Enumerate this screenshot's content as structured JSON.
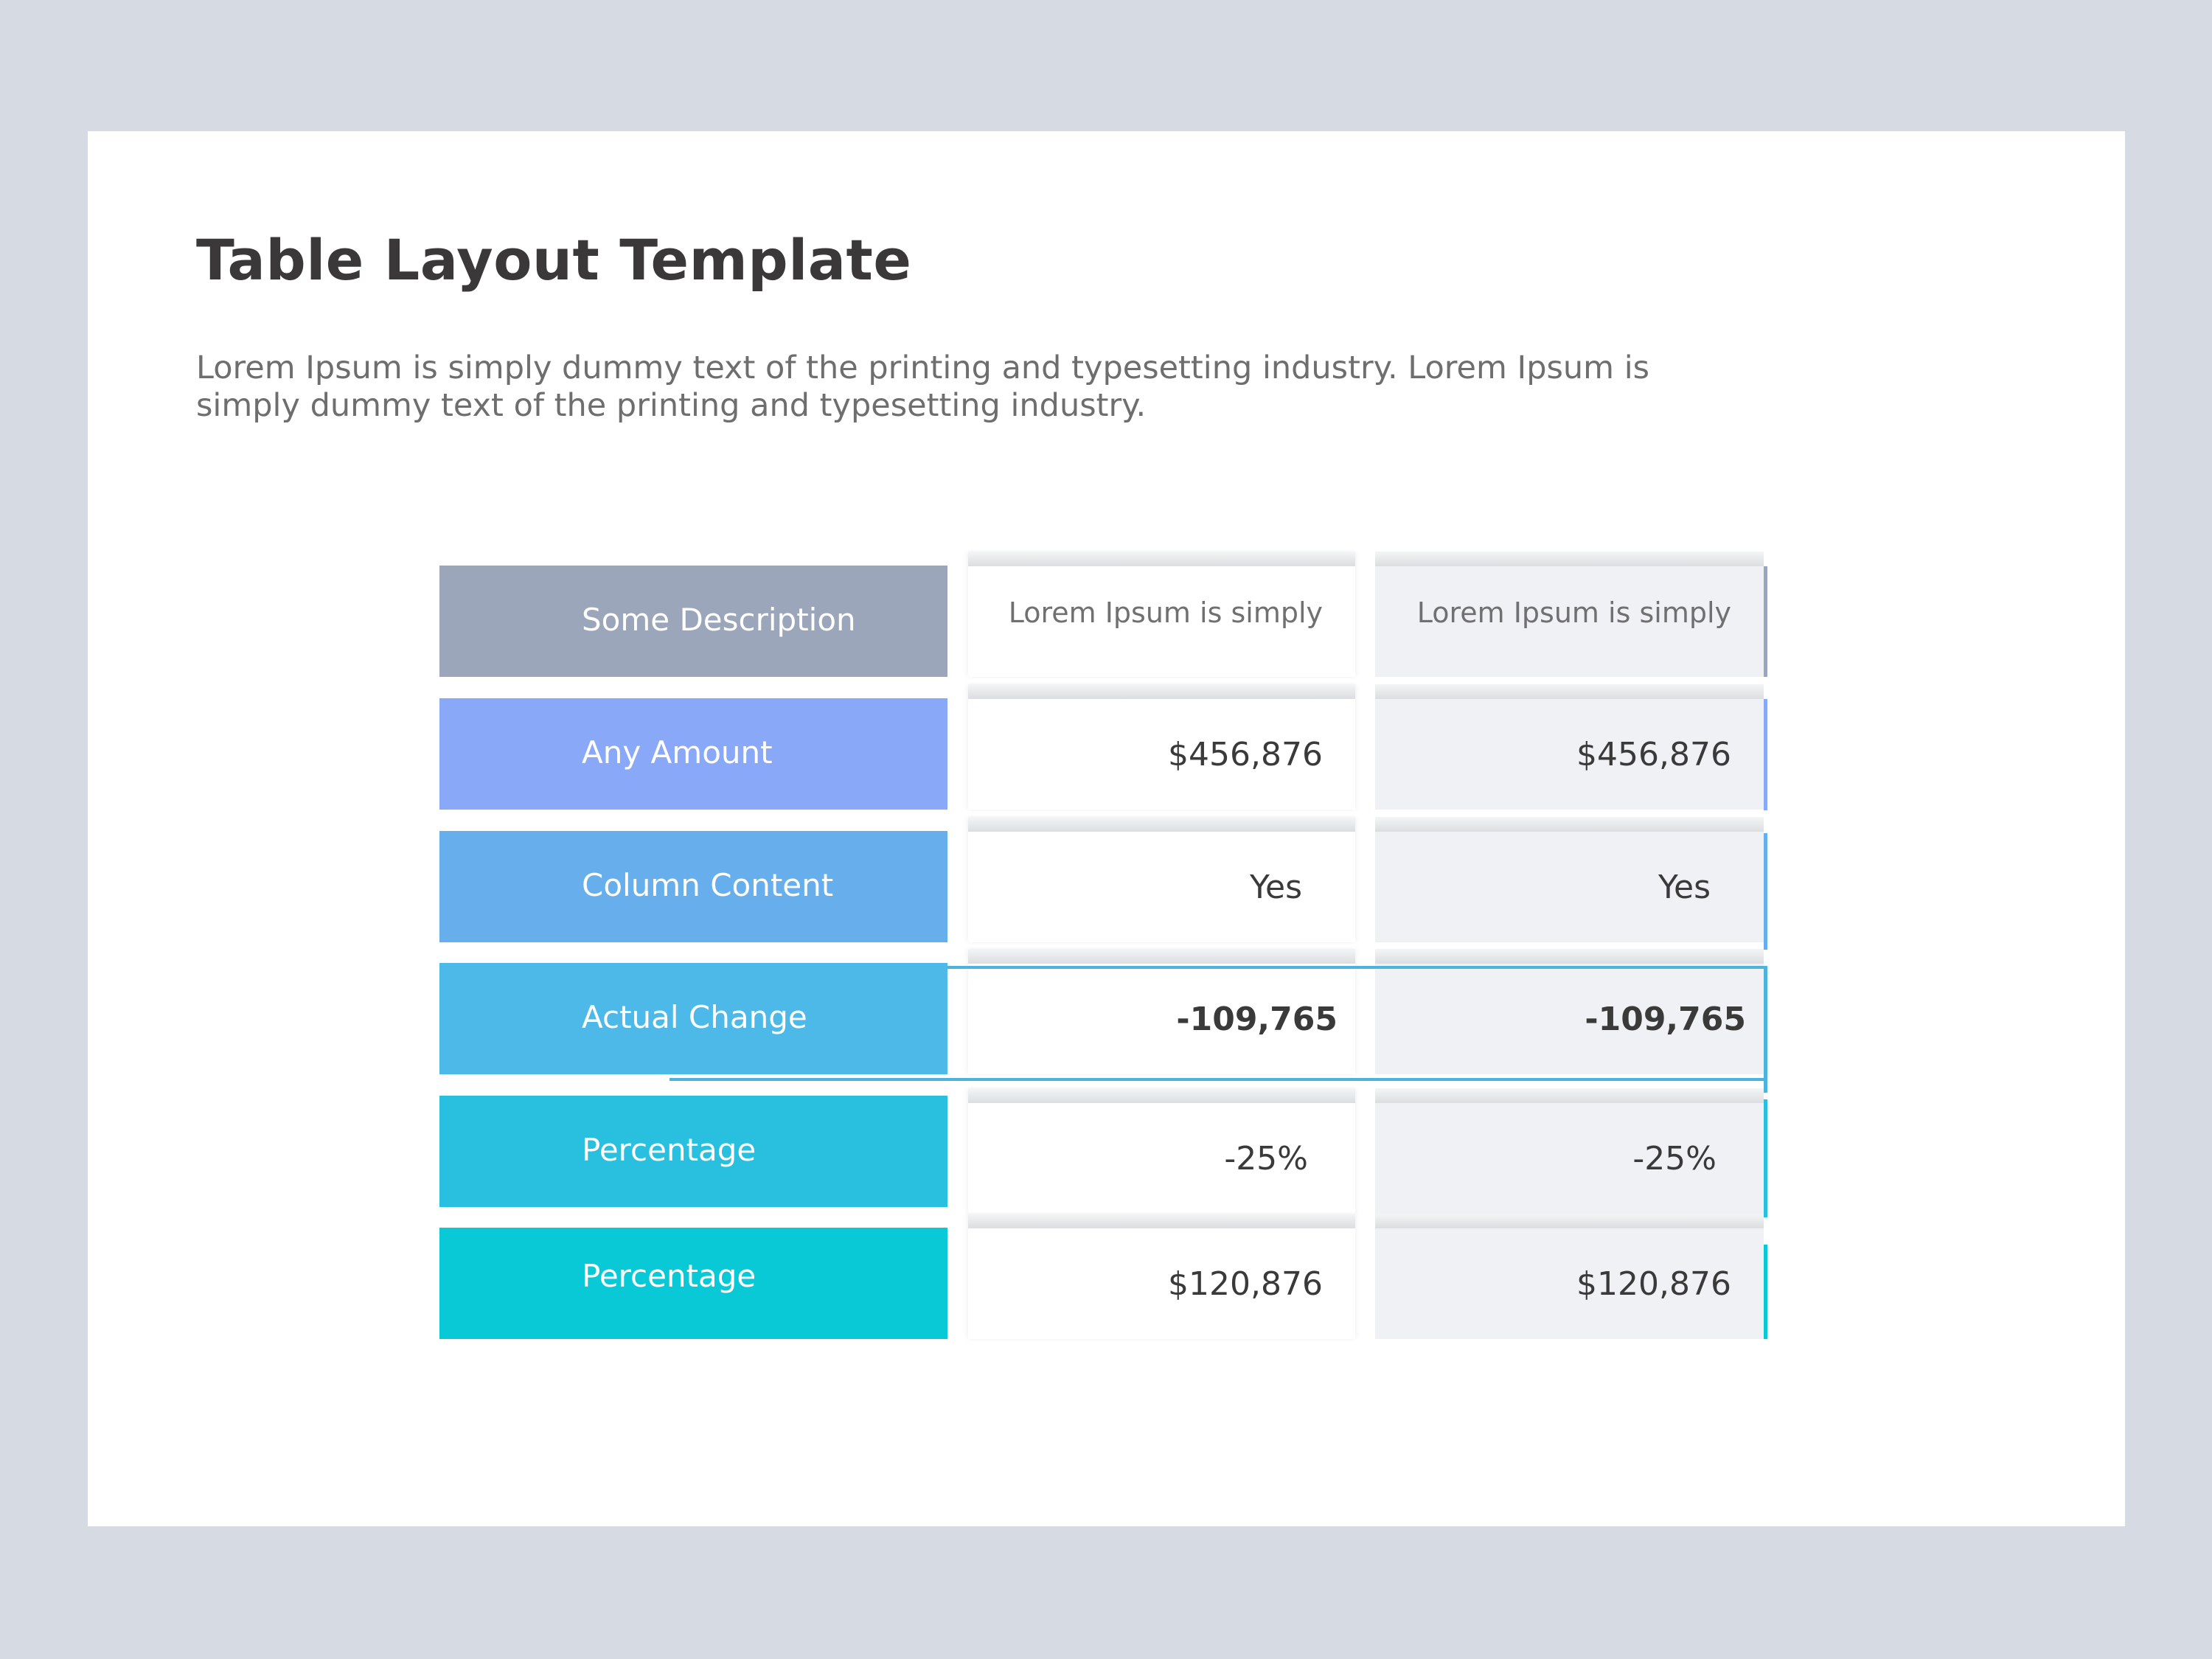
{
  "slide": {
    "title": "Table Layout Template",
    "description": "Lorem Ipsum is simply dummy text of the printing and typesetting industry. Lorem Ipsum is simply dummy text of the printing and typesetting industry."
  },
  "colors": {
    "page_background": "#d5dae3",
    "slide_background": "#ffffff",
    "column1_background": "#ffffff",
    "column2_background": "#eff1f5",
    "highlight_outline": "#4cb3dc"
  },
  "table": {
    "header": {
      "label": "Some Description",
      "label_color": "#9ca6bb",
      "col1": "Lorem Ipsum is simply",
      "col2": "Lorem Ipsum is simply"
    },
    "rows": [
      {
        "label": "Any Amount",
        "label_color": "#8aa8f8",
        "col1": "$456,876",
        "col2": "$456,876",
        "bold": false,
        "highlighted": false
      },
      {
        "label": "Column Content",
        "label_color": "#67aeed",
        "col1": "Yes",
        "col2": "Yes",
        "bold": false,
        "highlighted": false
      },
      {
        "label": "Actual Change",
        "label_color": "#4db9e9",
        "col1": "-109,765",
        "col2": "-109,765",
        "bold": true,
        "highlighted": true
      },
      {
        "label": "Percentage",
        "label_color": "#29c0e0",
        "col1": "-25%",
        "col2": "-25%",
        "bold": false,
        "highlighted": false
      },
      {
        "label": "Percentage",
        "label_color": "#0ac9d6",
        "col1": "$120,876",
        "col2": "$120,876",
        "bold": false,
        "highlighted": false
      }
    ]
  }
}
